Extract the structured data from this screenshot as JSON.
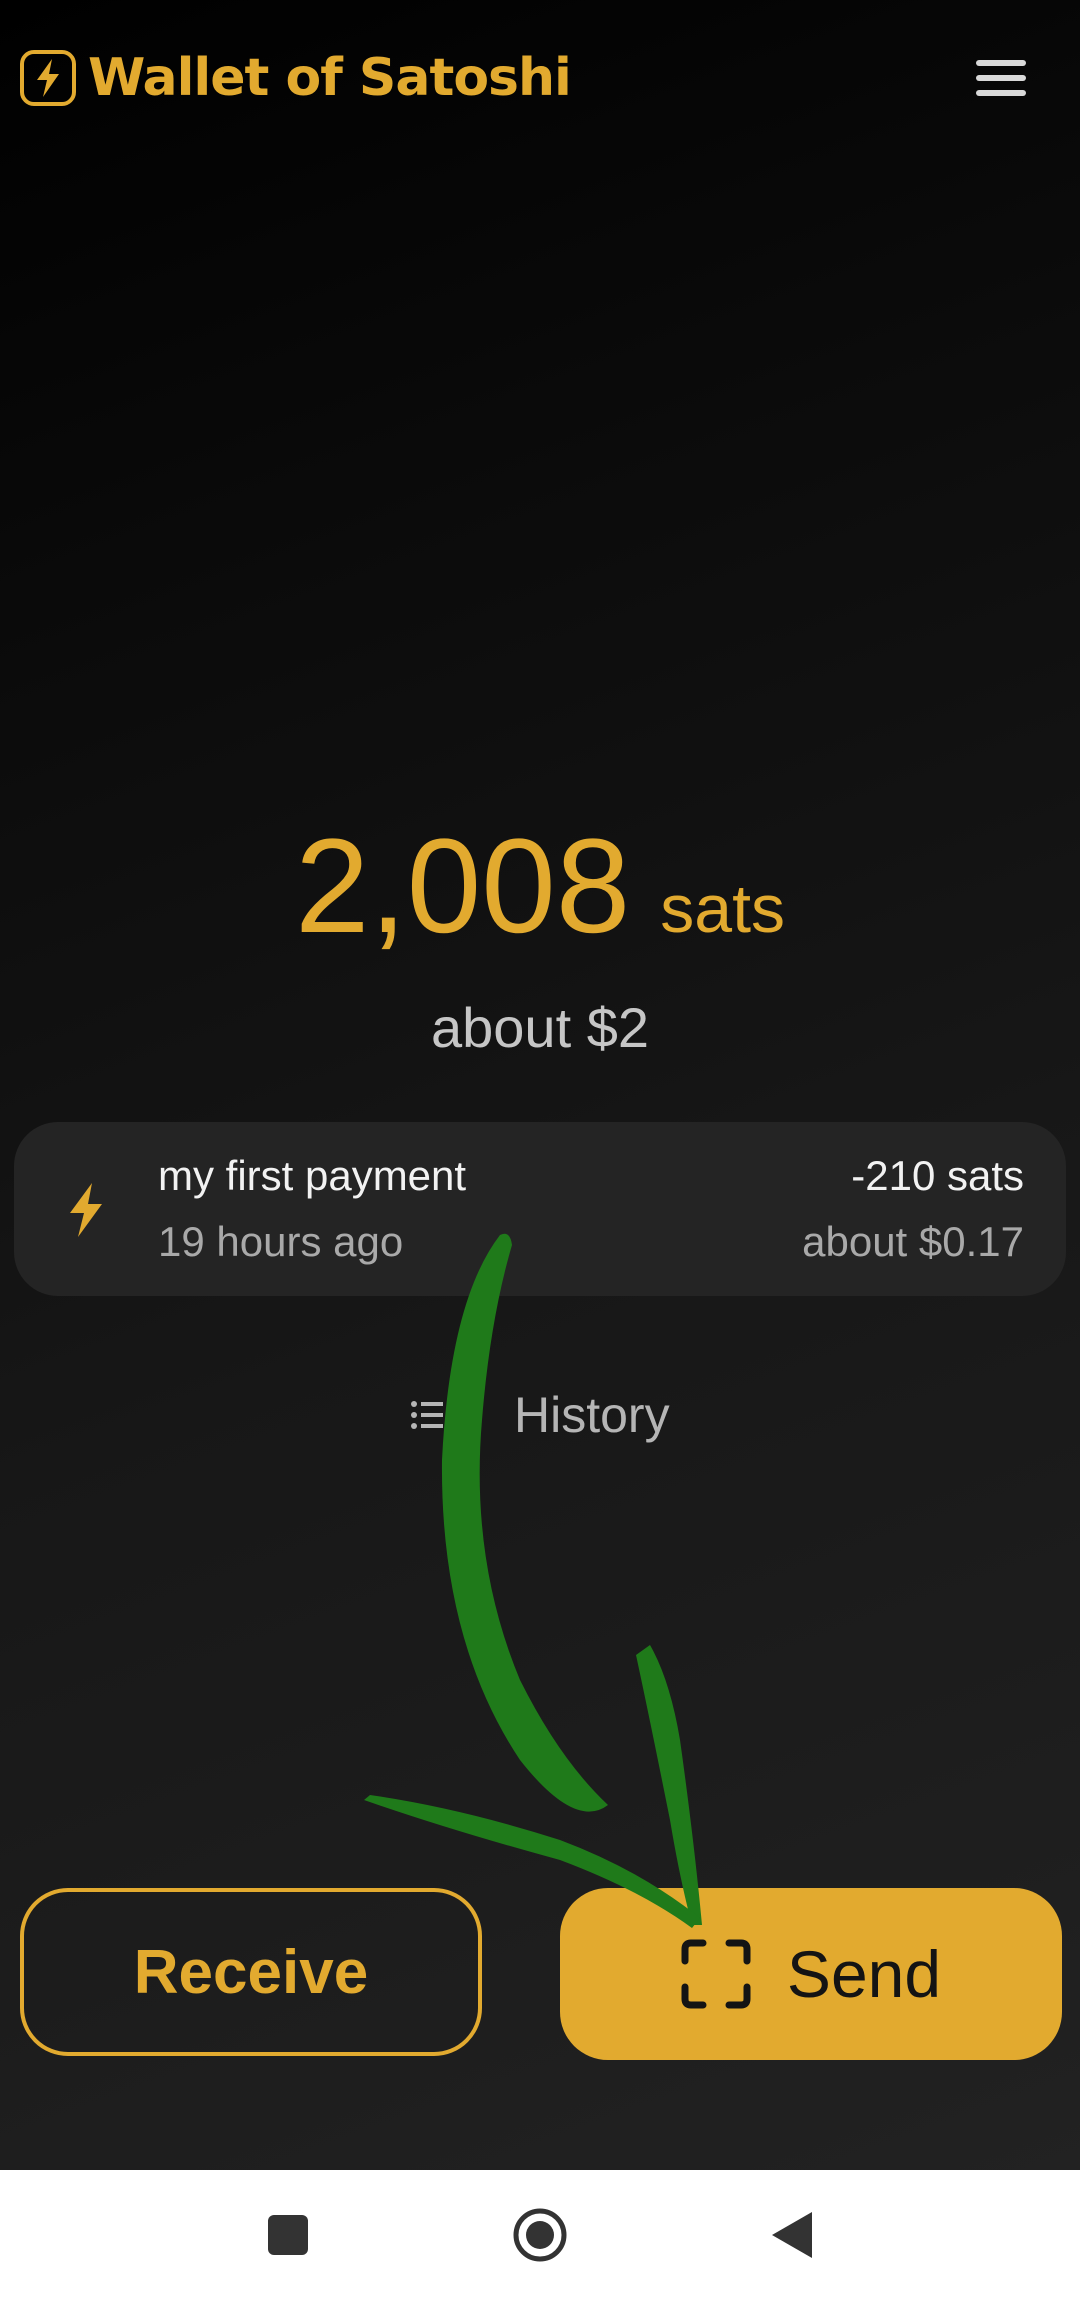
{
  "app": {
    "name": "Wallet of Satoshi",
    "brand_color": "#e2aa2f",
    "icons": {
      "logo": "lightning-bolt-icon",
      "menu": "hamburger-menu-icon"
    }
  },
  "balance": {
    "amount": "2,008",
    "unit": "sats",
    "fiat": "about $2"
  },
  "recent_transaction": {
    "icon": "lightning-bolt-icon",
    "title": "my first payment",
    "time": "19 hours ago",
    "amount": "-210 sats",
    "fiat": "about $0.17"
  },
  "history": {
    "icon": "list-icon",
    "label": "History"
  },
  "actions": {
    "receive_label": "Receive",
    "send_label": "Send",
    "send_icon": "scan-icon"
  },
  "annotation": {
    "arrow_color": "#1f7a1a"
  },
  "navbar": {
    "icons": [
      "recents-icon",
      "home-icon",
      "back-icon"
    ]
  }
}
